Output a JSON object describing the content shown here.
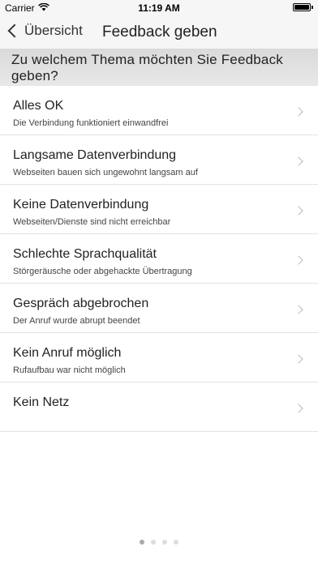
{
  "status_bar": {
    "carrier": "Carrier",
    "time": "11:19 AM",
    "battery_level": 1.0
  },
  "nav": {
    "back_label": "Übersicht",
    "title": "Feedback geben"
  },
  "section_header": "Zu welchem Thema möchten Sie Feedback geben?",
  "items": [
    {
      "title": "Alles OK",
      "subtitle": "Die Verbindung funktioniert einwandfrei"
    },
    {
      "title": "Langsame Datenverbindung",
      "subtitle": "Webseiten bauen sich ungewohnt langsam auf"
    },
    {
      "title": "Keine Datenverbindung",
      "subtitle": "Webseiten/Dienste sind nicht erreichbar"
    },
    {
      "title": "Schlechte Sprachqualität",
      "subtitle": "Störgeräusche oder abgehackte Übertragung"
    },
    {
      "title": "Gespräch abgebrochen",
      "subtitle": "Der Anruf wurde abrupt beendet"
    },
    {
      "title": "Kein Anruf möglich",
      "subtitle": "Rufaufbau war nicht möglich"
    },
    {
      "title": "Kein Netz",
      "subtitle": ""
    }
  ],
  "page_indicator": {
    "count": 4,
    "active_index": 0
  }
}
